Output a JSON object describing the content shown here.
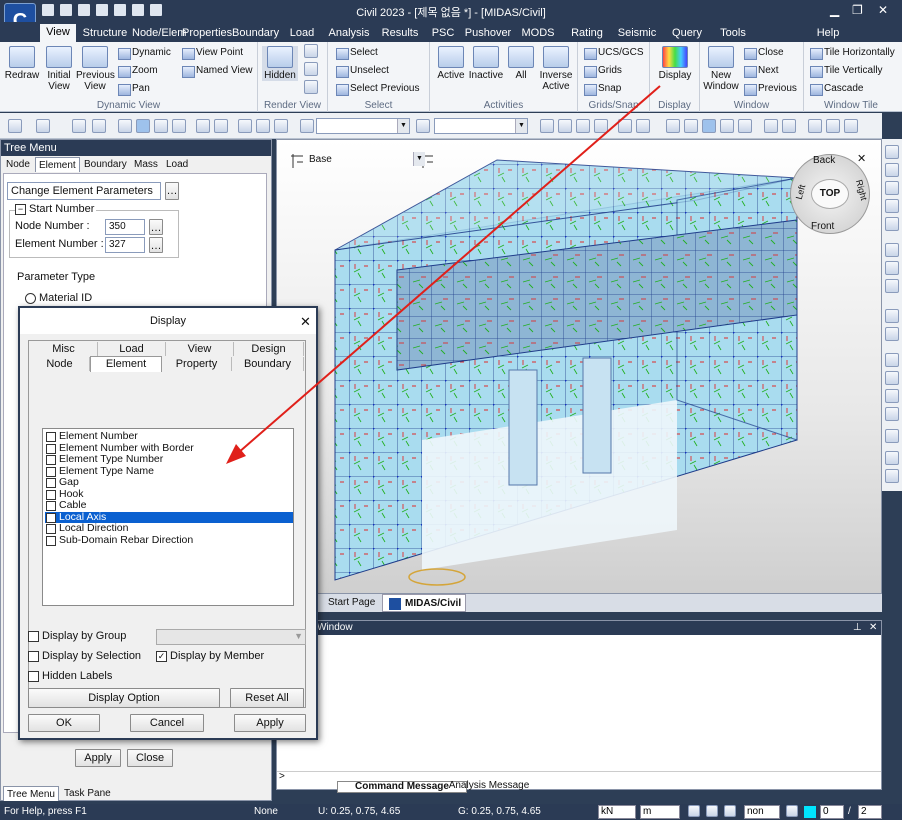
{
  "window": {
    "title": "Civil 2023 - [제목 없음 *] - [MIDAS/Civil]",
    "help": "Help",
    "logo": "C"
  },
  "tabs": [
    "View",
    "Structure",
    "Node/Elem",
    "Properties",
    "Boundary",
    "Load",
    "Analysis",
    "Results",
    "PSC",
    "Pushover",
    "MODS",
    "Rating",
    "Seismic Pe",
    "Query",
    "Tools"
  ],
  "ribbon": {
    "dynamic_view": {
      "label": "Dynamic View",
      "redraw": "Redraw",
      "initial": "Initial View",
      "previous": "Previous View",
      "dynamic": "Dynamic",
      "zoom": "Zoom",
      "pan": "Pan",
      "view_point": "View Point",
      "named_view": "Named View"
    },
    "render_view": {
      "label": "Render View",
      "hidden": "Hidden"
    },
    "select": {
      "label": "Select",
      "select": "Select",
      "unselect": "Unselect",
      "select_previous": "Select Previous"
    },
    "activities": {
      "label": "Activities",
      "active": "Active",
      "inactive": "Inactive",
      "all": "All",
      "inverse": "Inverse Active"
    },
    "grids": {
      "label": "Grids/Snap",
      "ucs": "UCS/GCS",
      "grids": "Grids",
      "snap": "Snap"
    },
    "display": {
      "label": "Display",
      "display": "Display"
    },
    "window": {
      "label": "Window",
      "new_window": "New Window",
      "close": "Close",
      "next": "Next",
      "previous": "Previous"
    },
    "window_tile": {
      "label": "Window Tile",
      "tile_h": "Tile Horizontally",
      "tile_v": "Tile Vertically",
      "cascade": "Cascade"
    }
  },
  "tree": {
    "title": "Tree Menu",
    "tabs": [
      "Node",
      "Element",
      "Boundary",
      "Mass",
      "Load"
    ],
    "dropdown": "Change Element Parameters",
    "start_number": "Start Number",
    "node_number_label": "Node Number :",
    "node_number": "350",
    "element_number_label": "Element Number :",
    "element_number": "327",
    "parameter_type": "Parameter Type",
    "material_id": "Material ID",
    "apply": "Apply",
    "close": "Close",
    "bottom_tabs": [
      "Tree Menu",
      "Task Pane"
    ]
  },
  "viewport": {
    "ucs_name": "Base",
    "nav": {
      "back": "Back",
      "top": "TOP",
      "left": "Left",
      "right": "Right",
      "front": "Front"
    },
    "tabs": [
      "Start Page",
      "MIDAS/Civil"
    ]
  },
  "output": {
    "title": "Window",
    "tabs": [
      "Command Message",
      "Analysis Message"
    ],
    "prompt": ">"
  },
  "dialog": {
    "title": "Display",
    "tabs_row1": [
      "Misc",
      "Load",
      "View",
      "Design"
    ],
    "tabs_row2": [
      "Node",
      "Element",
      "Property",
      "Boundary"
    ],
    "items": [
      {
        "label": "Element Number",
        "checked": false
      },
      {
        "label": "Element Number with Border",
        "checked": false
      },
      {
        "label": "Element Type Number",
        "checked": false
      },
      {
        "label": "Element Type Name",
        "checked": false
      },
      {
        "label": "Gap",
        "checked": false
      },
      {
        "label": "Hook",
        "checked": false
      },
      {
        "label": "Cable",
        "checked": false
      },
      {
        "label": "Local Axis",
        "checked": true
      },
      {
        "label": "Local Direction",
        "checked": false
      },
      {
        "label": "Sub-Domain Rebar Direction",
        "checked": false
      }
    ],
    "display_by_group": "Display by Group",
    "display_by_selection": "Display by Selection",
    "display_by_member": "Display by Member",
    "hidden_labels": "Hidden Labels",
    "display_option": "Display Option",
    "reset_all": "Reset All",
    "ok": "OK",
    "cancel": "Cancel",
    "apply": "Apply"
  },
  "status": {
    "help": "For Help, press F1",
    "none": "None",
    "u": "U: 0.25, 0.75, 4.65",
    "g": "G: 0.25, 0.75, 4.65",
    "force_unit": "kN",
    "length_unit": "m",
    "non": "non",
    "page": "0",
    "total": "2",
    "sep": "/"
  },
  "colors": {
    "title_bg": "#2b3b55",
    "accent": "#0a60d0",
    "arrow": "#e0201a",
    "model": "#a9dcef"
  }
}
